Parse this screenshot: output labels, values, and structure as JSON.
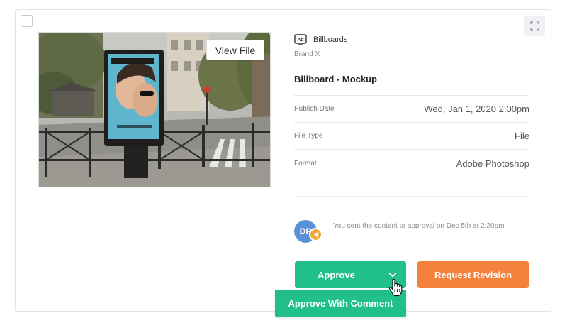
{
  "card": {
    "view_file_label": "View File",
    "channel": {
      "icon": "ad-icon",
      "name": "Billboards"
    },
    "brand": "Brand X",
    "title": "Billboard - Mockup",
    "meta": [
      {
        "label": "Publish Date",
        "value": "Wed, Jan 1, 2020 2:00pm"
      },
      {
        "label": "File Type",
        "value": "File"
      },
      {
        "label": "Format",
        "value": "Adobe Photoshop"
      }
    ],
    "approval": {
      "avatar_initials": "DP",
      "message": "You sent the content to approval on Dec 5th at 2:20pm"
    },
    "actions": {
      "approve_label": "Approve",
      "request_revision_label": "Request Revision",
      "approve_with_comment_label": "Approve With Comment"
    }
  },
  "colors": {
    "approve": "#21bf8b",
    "revision": "#f5813d",
    "avatar": "#5b8fd6",
    "send_badge": "#f2a93b"
  }
}
